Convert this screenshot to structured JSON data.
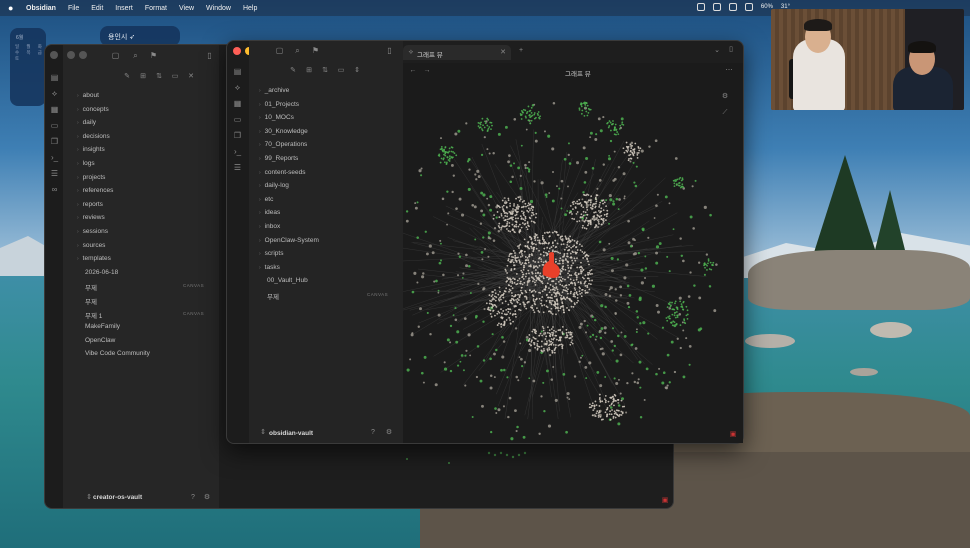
{
  "menubar": {
    "app": "Obsidian",
    "items": [
      "File",
      "Edit",
      "Insert",
      "Format",
      "View",
      "Window",
      "Help"
    ],
    "battery": "60%",
    "temp": "31°"
  },
  "widgets": {
    "calendar_month": "6월",
    "calendar_days": "일 월 화 수 목 금 토",
    "weather_city": "용인시 ➶"
  },
  "back_window": {
    "vault_name": "creator-os-vault",
    "folders": [
      {
        "label": "about",
        "folder": true
      },
      {
        "label": "concepts",
        "folder": true
      },
      {
        "label": "daily",
        "folder": true
      },
      {
        "label": "decisions",
        "folder": true
      },
      {
        "label": "insights",
        "folder": true
      },
      {
        "label": "logs",
        "folder": true
      },
      {
        "label": "projects",
        "folder": true
      },
      {
        "label": "references",
        "folder": true
      },
      {
        "label": "reports",
        "folder": true
      },
      {
        "label": "reviews",
        "folder": true
      },
      {
        "label": "sessions",
        "folder": true
      },
      {
        "label": "sources",
        "folder": true
      },
      {
        "label": "templates",
        "folder": true
      },
      {
        "label": "2026-06-18",
        "folder": false
      },
      {
        "label": "무제",
        "folder": false,
        "badge": "CANVAS"
      },
      {
        "label": "무제",
        "folder": false
      },
      {
        "label": "무제 1",
        "folder": false,
        "badge": "CANVAS"
      },
      {
        "label": "MakeFamily",
        "folder": false
      },
      {
        "label": "OpenClaw",
        "folder": false
      },
      {
        "label": "Vibe Code Community",
        "folder": false
      }
    ]
  },
  "front_window": {
    "vault_name": "obsidian-vault",
    "tab_label": "그래프 뷰",
    "graph_title": "그래프 뷰",
    "folders": [
      {
        "label": "_archive",
        "folder": true
      },
      {
        "label": "01_Projects",
        "folder": true
      },
      {
        "label": "10_MOCs",
        "folder": true
      },
      {
        "label": "30_Knowledge",
        "folder": true
      },
      {
        "label": "70_Operations",
        "folder": true
      },
      {
        "label": "99_Reports",
        "folder": true
      },
      {
        "label": "content-seeds",
        "folder": true
      },
      {
        "label": "daily-log",
        "folder": true
      },
      {
        "label": "etc",
        "folder": true
      },
      {
        "label": "ideas",
        "folder": true
      },
      {
        "label": "inbox",
        "folder": true
      },
      {
        "label": "OpenClaw-System",
        "folder": true
      },
      {
        "label": "scripts",
        "folder": true
      },
      {
        "label": "tasks",
        "folder": true
      },
      {
        "label": "00_Vault_Hub",
        "folder": false
      },
      {
        "label": "무제",
        "folder": false,
        "badge": "CANVAS"
      }
    ]
  },
  "colors": {
    "node_gray": "#cfc8bd",
    "node_green": "#4caf50",
    "center_red": "#e8402a",
    "window_bg": "#1e1e1e"
  }
}
